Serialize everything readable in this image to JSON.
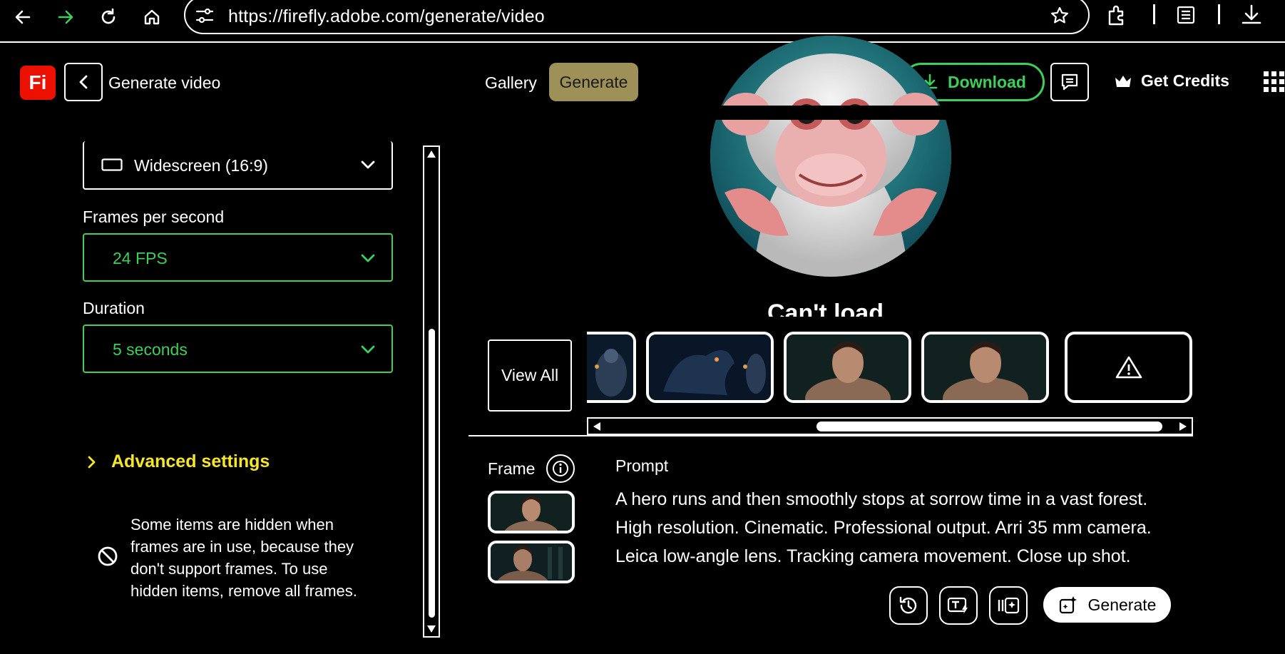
{
  "browser": {
    "url": "https://firefly.adobe.com/generate/video"
  },
  "header": {
    "logo_text": "Fi",
    "title": "Generate video",
    "tabs": [
      {
        "label": "Gallery"
      },
      {
        "label": "Generate"
      }
    ],
    "download_label": "Download",
    "credits_label": "Get Credits"
  },
  "left_panel": {
    "aspect_ratio": "Widescreen (16:9)",
    "fps_label": "Frames per second",
    "fps_value": "24 FPS",
    "duration_label": "Duration",
    "duration_value": "5 seconds",
    "advanced_label": "Advanced settings",
    "notice": "Some items are hidden when frames are in use, because they don't support frames. To use hidden items, remove all frames."
  },
  "preview": {
    "cant_load": "Can't load"
  },
  "gallery": {
    "view_all_label": "View All"
  },
  "bottom": {
    "frame_label": "Frame",
    "prompt_label": "Prompt",
    "prompt_text": "A hero runs and then smoothly stops at sorrow time in a vast forest. High resolution. Cinematic. Professional output. Arri 35 mm camera. Leica low-angle lens. Tracking camera movement. Close up shot.",
    "generate_label": "Generate"
  },
  "colors": {
    "accent_green": "#3ecf5a",
    "advanced_yellow": "#f5e62a",
    "generate_tab": "#9e9157",
    "logo_red": "#eb1000"
  }
}
